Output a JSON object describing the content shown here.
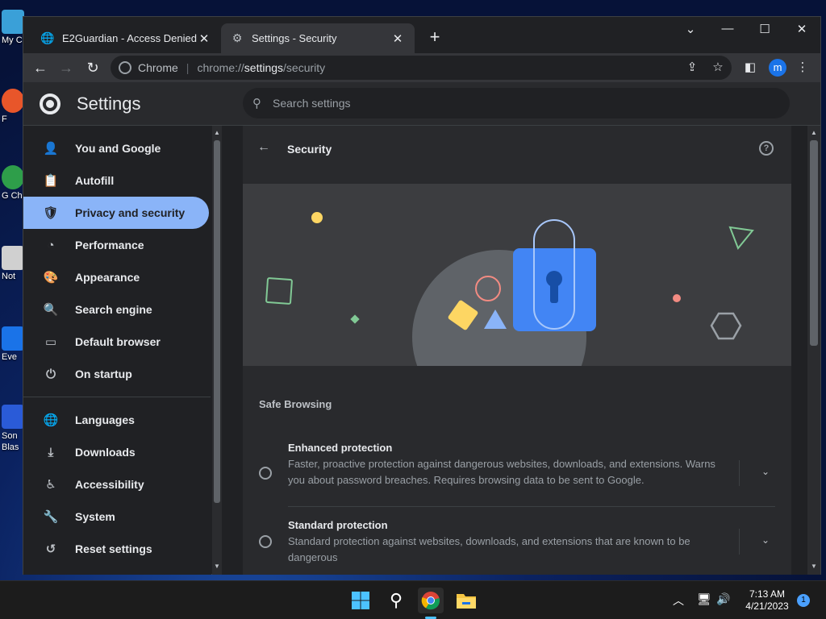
{
  "desktop": {
    "icons": [
      {
        "label": "My C",
        "color": "#3aa0d8"
      },
      {
        "label": "F",
        "color": "#e8562a"
      },
      {
        "label": "G Ch",
        "color": "#2e9e4a"
      },
      {
        "label": "Not",
        "color": "#d0d0d0"
      },
      {
        "label": "Eve",
        "color": "#1a73e8"
      },
      {
        "label": "Son Blas",
        "color": "#2a5bd8"
      }
    ]
  },
  "tabs": [
    {
      "title": "E2Guardian - Access Denied",
      "close": "✕"
    },
    {
      "title": "Settings - Security",
      "close": "✕"
    }
  ],
  "window_controls": {
    "minimize": "⌄",
    "restore": "—",
    "maximize": "☐",
    "close": "✕"
  },
  "toolbar": {
    "back": "←",
    "forward": "→",
    "reload": "↻",
    "chrome_label": "Chrome",
    "url_scheme": "chrome://",
    "url_host": "settings",
    "url_path": "/security",
    "avatar_letter": "m"
  },
  "settings": {
    "title": "Settings",
    "search_placeholder": "Search settings"
  },
  "sidebar": {
    "items": [
      {
        "label": "You and Google",
        "icon": "person-icon",
        "glyph": "👤"
      },
      {
        "label": "Autofill",
        "icon": "clipboard-icon",
        "glyph": "📋"
      },
      {
        "label": "Privacy and security",
        "icon": "shield-icon",
        "glyph": "🛡",
        "selected": true
      },
      {
        "label": "Performance",
        "icon": "gauge-icon",
        "glyph": "◔"
      },
      {
        "label": "Appearance",
        "icon": "palette-icon",
        "glyph": "🎨"
      },
      {
        "label": "Search engine",
        "icon": "search-icon",
        "glyph": "🔍"
      },
      {
        "label": "Default browser",
        "icon": "browser-icon",
        "glyph": "▭"
      },
      {
        "label": "On startup",
        "icon": "power-icon",
        "glyph": "⏻"
      },
      {
        "label": "Languages",
        "icon": "globe-icon",
        "glyph": "🌐"
      },
      {
        "label": "Downloads",
        "icon": "download-icon",
        "glyph": "⤓"
      },
      {
        "label": "Accessibility",
        "icon": "accessibility-icon",
        "glyph": "♿"
      },
      {
        "label": "System",
        "icon": "wrench-icon",
        "glyph": "🔧"
      },
      {
        "label": "Reset settings",
        "icon": "reset-icon",
        "glyph": "↺"
      }
    ]
  },
  "security": {
    "title": "Security",
    "section_title": "Safe Browsing",
    "options": [
      {
        "title": "Enhanced protection",
        "desc": "Faster, proactive protection against dangerous websites, downloads, and extensions. Warns you about password breaches. Requires browsing data to be sent to Google."
      },
      {
        "title": "Standard protection",
        "desc": "Standard protection against websites, downloads, and extensions that are known to be dangerous"
      }
    ]
  },
  "taskbar": {
    "time": "7:13 AM",
    "date": "4/21/2023",
    "notification_count": "1"
  }
}
